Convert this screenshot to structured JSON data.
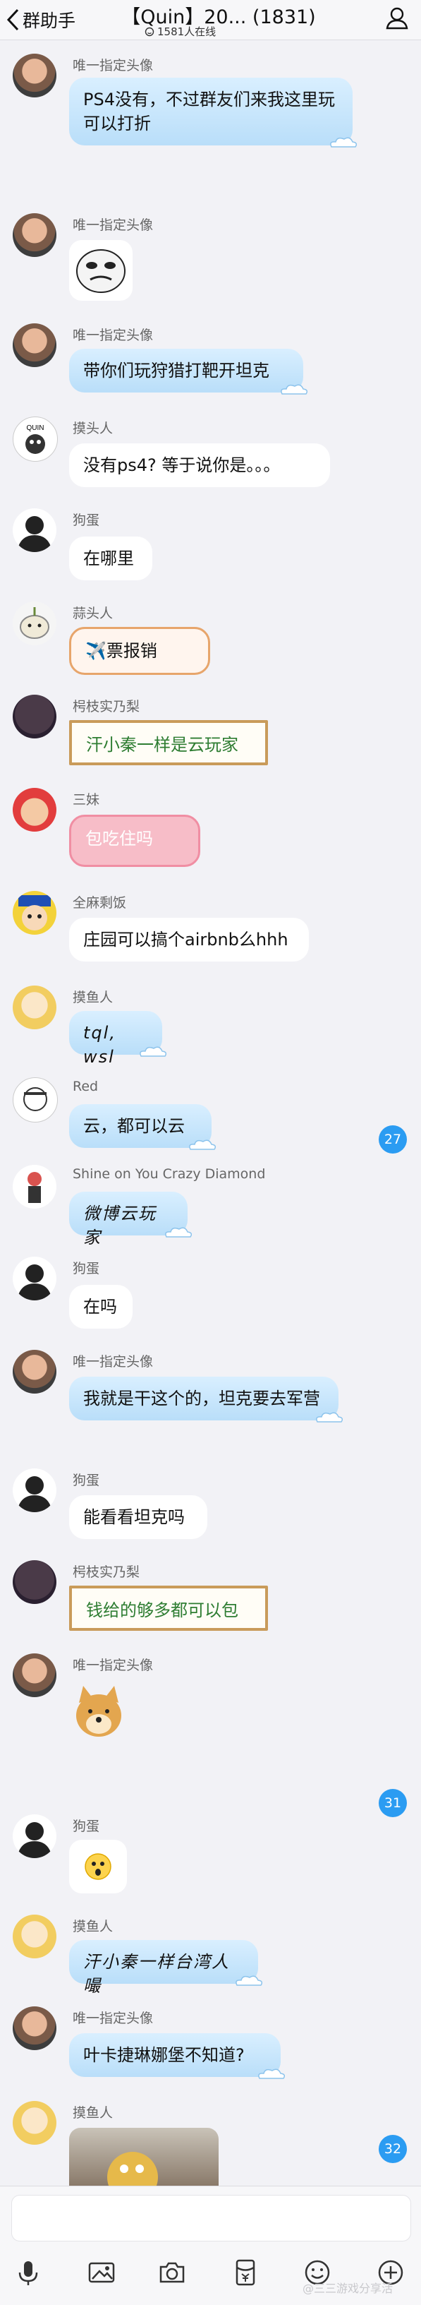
{
  "header": {
    "back_label": "群助手",
    "title": "【Quin】20... (1831)",
    "online": "1581人在线"
  },
  "messages": [
    {
      "sender": "唯一指定头像",
      "text": "PS4没有，不过群友们来我这里玩可以打折"
    },
    {
      "sender": "唯一指定头像",
      "text": ""
    },
    {
      "sender": "唯一指定头像",
      "text": "带你们玩狩猎打靶开坦克"
    },
    {
      "sender": "摸头人",
      "text": "没有ps4? 等于说你是。。。"
    },
    {
      "sender": "狗蛋",
      "text": "在哪里"
    },
    {
      "sender": "蒜头人",
      "text": "✈️票报销"
    },
    {
      "sender": "枵枝实乃梨",
      "text": "汗小秦一样是云玩家"
    },
    {
      "sender": "三妹",
      "text": "包吃住吗"
    },
    {
      "sender": "全麻剩饭",
      "text": "庄园可以搞个airbnb么hhh"
    },
    {
      "sender": "摸鱼人",
      "text": "tql, wsl"
    },
    {
      "sender": "Red",
      "text": "云，都可以云"
    },
    {
      "sender": "Shine on You Crazy Diamond",
      "text": "微博云玩家"
    },
    {
      "sender": "狗蛋",
      "text": "在吗"
    },
    {
      "sender": "唯一指定头像",
      "text": "我就是干这个的，坦克要去军营"
    },
    {
      "sender": "狗蛋",
      "text": "能看看坦克吗"
    },
    {
      "sender": "枵枝实乃梨",
      "text": "钱给的够多都可以包"
    },
    {
      "sender": "唯一指定头像",
      "text": ""
    },
    {
      "sender": "狗蛋",
      "text": ""
    },
    {
      "sender": "摸鱼人",
      "text": "汗小秦一样台湾人嘬"
    },
    {
      "sender": "唯一指定头像",
      "text": "叶卡捷琳娜堡不知道?"
    },
    {
      "sender": "摸鱼人",
      "text": ""
    }
  ],
  "badges": [
    "27",
    "31",
    "32"
  ],
  "watermark": "@三三游戏分享活",
  "colors": {
    "accent": "#2b9cf2",
    "bubble_blue": "#c4e4fb",
    "frame": "#c99b5a"
  }
}
